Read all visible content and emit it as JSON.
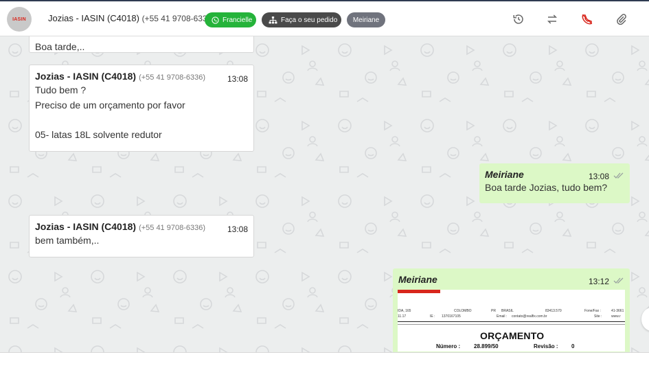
{
  "header": {
    "avatar_logo": "IASIN",
    "contact_name": "Jozias - IASIN (C4018)",
    "contact_phone": "(+55 41 9708-6336)",
    "chips": {
      "green_label": "Francielle",
      "dark_label": "Faça o seu pedido",
      "gray_label": "Meiriane"
    },
    "colors": {
      "green": "#25b33a",
      "dark": "#4a4a4a",
      "gray": "#70737d",
      "call": "#d8261c"
    },
    "icons": [
      "history-icon",
      "transfer-icon",
      "end-call-icon",
      "attach-icon"
    ]
  },
  "messages": [
    {
      "direction": "in",
      "body": "Boa tarde,.."
    },
    {
      "direction": "in",
      "sender": "Jozias - IASIN (C4018)",
      "phone": "(+55 41 9708-6336)",
      "time": "13:08",
      "body": "Tudo bem ?\nPreciso de um orçamento por favor\n\n05- latas 18L solvente redutor"
    },
    {
      "direction": "out",
      "sender": "Meiriane",
      "time": "13:08",
      "body": "Boa tarde Jozias, tudo bem?"
    },
    {
      "direction": "in",
      "sender": "Jozias - IASIN (C4018)",
      "phone": "(+55 41 9708-6336)",
      "time": "13:08",
      "body": "bem também,.."
    },
    {
      "direction": "out",
      "sender": "Meiriane",
      "time": "13:12",
      "attachment": {
        "title": "ORÇAMENTO",
        "line1": [
          "IDA, 165",
          "COLOMBO",
          "PR",
          "BRASIL",
          "83413.570",
          "Fone/Fax :",
          "41-3661"
        ],
        "line2": [
          "11.17",
          "IE :",
          "1370167105",
          "Email :",
          "contato@realfix.com.br",
          "Site :",
          "www.r"
        ],
        "numero_label": "Número :",
        "numero_value": "28.899/50",
        "revisao_label": "Revisão :",
        "revisao_value": "0"
      }
    }
  ]
}
